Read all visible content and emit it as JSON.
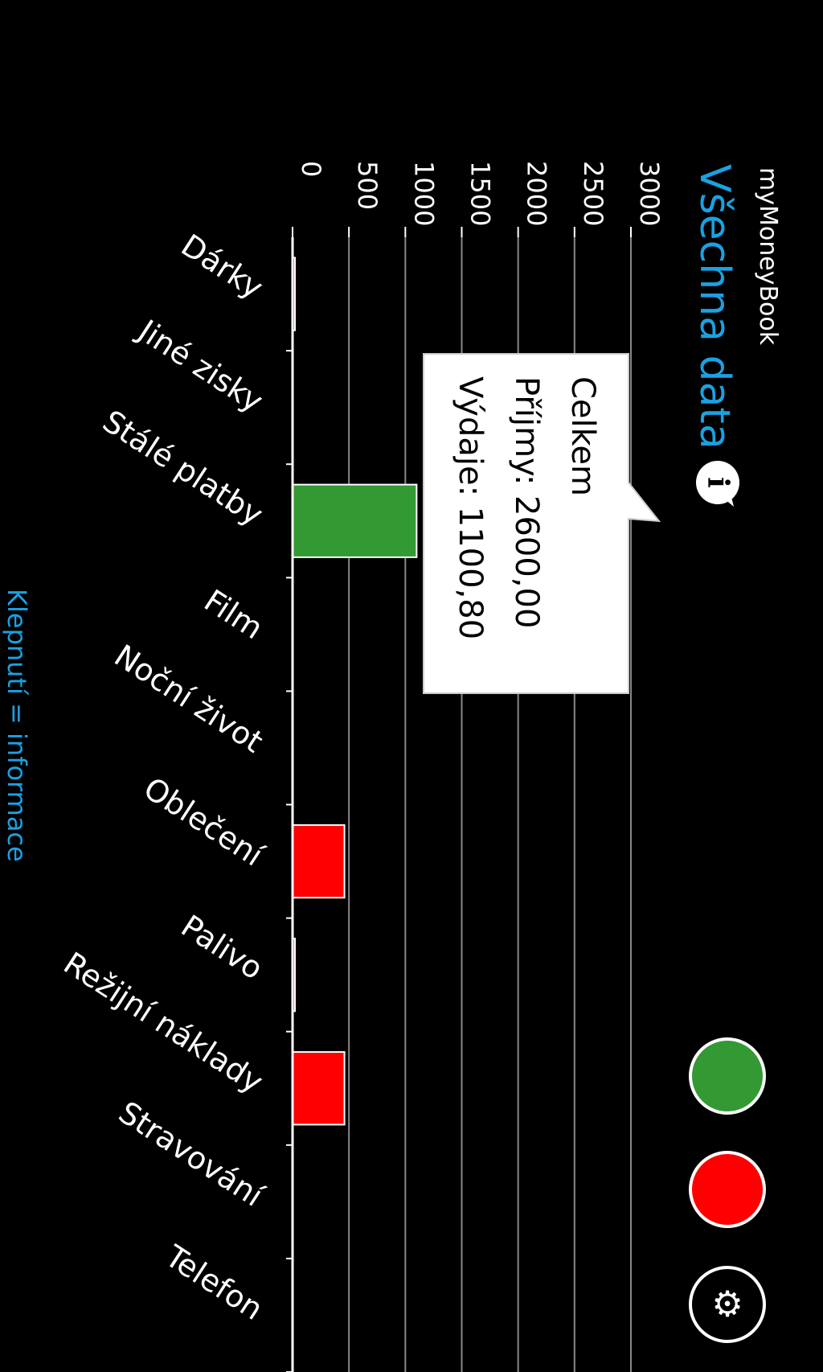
{
  "app": {
    "name": "myMoneyBook",
    "page_title": "Všechna data",
    "hint": "Klepnutí = informace"
  },
  "colors": {
    "accent": "#1ba1e2",
    "income": "#339933",
    "expense": "#ff0000",
    "background": "#000000",
    "foreground": "#ffffff"
  },
  "icons": {
    "info": "info-icon",
    "income_toggle": "income-circle-button",
    "expense_toggle": "expense-circle-button",
    "settings": "gear-icon"
  },
  "tooltip": {
    "title": "Celkem",
    "income_line": "Příjmy: 2600,00",
    "expense_line": "Výdaje: 1100,80"
  },
  "chart_data": {
    "type": "bar",
    "categories": [
      "Dárky",
      "Jiné zisky",
      "Stálé platby",
      "Film",
      "Noční život",
      "Oblečení",
      "Palivo",
      "Režijní náklady",
      "Stravování",
      "Telefon"
    ],
    "series": [
      {
        "color": "#339933",
        "values": [
          0,
          0,
          1100,
          0,
          0,
          0,
          0,
          0,
          0,
          0
        ]
      },
      {
        "color": "#ff0000",
        "values": [
          5,
          0,
          0,
          0,
          0,
          460,
          20,
          460,
          0,
          0
        ]
      }
    ],
    "ytick_labels": [
      "0",
      "500",
      "1000",
      "1500",
      "2000",
      "2500",
      "3000"
    ],
    "yticks": [
      0,
      500,
      1000,
      1500,
      2000,
      2500,
      3000
    ],
    "ylim": [
      0,
      3000
    ],
    "grid": true
  }
}
